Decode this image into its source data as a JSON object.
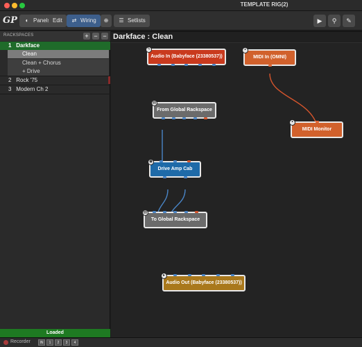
{
  "window": {
    "title": "TEMPLATE RIG(2)"
  },
  "toolbar": {
    "logo": "GP",
    "panels": "Panels",
    "edit": "Edit",
    "wiring": "Wiring",
    "setlists": "Setlists",
    "accent": "#3d5f8c"
  },
  "sidebar": {
    "header": "RACKSPACES",
    "add": "+",
    "remove": "−",
    "collapse": "−",
    "rackspaces": [
      {
        "num": "1",
        "name": "Darkface"
      },
      {
        "num": "2",
        "name": "Rock '75"
      },
      {
        "num": "3",
        "name": "Modern Ch 2"
      }
    ],
    "variations": [
      "Clean",
      "Clean + Chorus",
      "+ Drive"
    ],
    "status": "Loaded",
    "status_color": "#1e7a22"
  },
  "main": {
    "title": "Darkface : Clean",
    "blocks": {
      "audio_in": "Audio In (Babyface (23380537))",
      "midi_in": "MIDI In (OMNI)",
      "from_global": "From Global Rackspace",
      "midi_monitor": "MIDI Monitor",
      "drive_amp": "Drive Amp Cab",
      "to_global": "To Global Rackspace",
      "audio_out": "Audio Out (Babyface (23380537))"
    }
  },
  "bottom": {
    "recorder": "Recorder",
    "buttons": [
      "IN",
      "1",
      "2",
      "3",
      "4"
    ]
  }
}
